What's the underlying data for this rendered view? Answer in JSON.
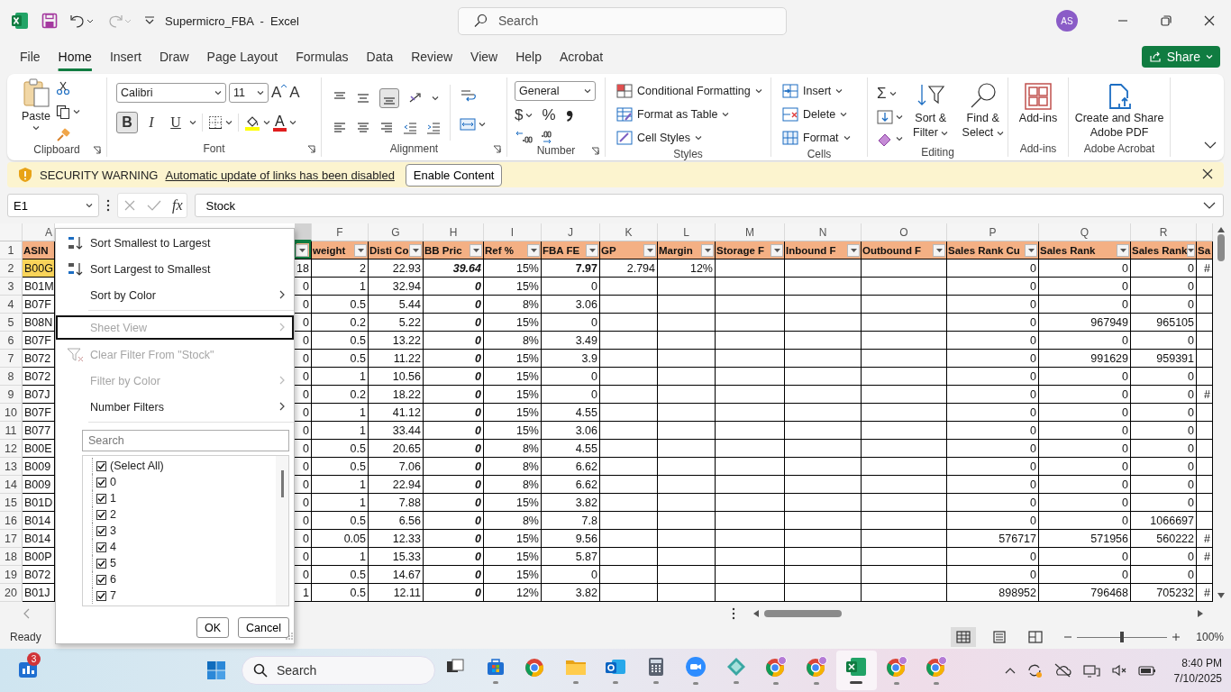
{
  "title_bar": {
    "title": "Supermicro_FBA  -  Excel",
    "search_placeholder": "Search",
    "user_initials": "AS"
  },
  "tabs": [
    {
      "label": "File",
      "selected": false
    },
    {
      "label": "Home",
      "selected": true
    },
    {
      "label": "Insert",
      "selected": false
    },
    {
      "label": "Draw",
      "selected": false
    },
    {
      "label": "Page Layout",
      "selected": false
    },
    {
      "label": "Formulas",
      "selected": false
    },
    {
      "label": "Data",
      "selected": false
    },
    {
      "label": "Review",
      "selected": false
    },
    {
      "label": "View",
      "selected": false
    },
    {
      "label": "Help",
      "selected": false
    },
    {
      "label": "Acrobat",
      "selected": false
    }
  ],
  "share_button": "Share",
  "ribbon": {
    "groups": [
      {
        "kind": "clipboard",
        "label": "Clipboard",
        "launcher": true,
        "paste": "Paste"
      },
      {
        "kind": "font",
        "label": "Font",
        "launcher": true,
        "font_name": "Calibri",
        "font_size": "11",
        "grow": "A",
        "shrink": "A",
        "bold": {
          "label": "B",
          "pressed": true
        },
        "italic": {
          "label": "I",
          "pressed": false
        },
        "underline": {
          "label": "U",
          "pressed": false
        },
        "font_color": "A"
      },
      {
        "kind": "alignment",
        "label": "Alignment",
        "launcher": true,
        "bottom_align_pressed": true
      },
      {
        "kind": "number",
        "label": "Number",
        "launcher": true,
        "format": "General",
        "currency": "$",
        "percent": "%"
      },
      {
        "kind": "styles",
        "label": "Styles",
        "launcher": false,
        "items": [
          "Conditional Formatting",
          "Format as Table",
          "Cell Styles"
        ]
      },
      {
        "kind": "cells",
        "label": "Cells",
        "launcher": false,
        "items": [
          "Insert",
          "Delete",
          "Format"
        ]
      },
      {
        "kind": "editing",
        "label": "Editing",
        "launcher": false,
        "autosum": "Σ",
        "items": [
          "Sort & Filter",
          "Find & Select"
        ]
      },
      {
        "kind": "addins",
        "label": "Add-ins",
        "launcher": false,
        "button": "Add-ins"
      },
      {
        "kind": "acrobat",
        "label": "Adobe Acrobat",
        "launcher": false,
        "button": "Create and Share Adobe PDF"
      }
    ]
  },
  "security_bar": {
    "label": "SECURITY WARNING",
    "message": "Automatic update of links has been disabled",
    "button": "Enable Content"
  },
  "formula_bar": {
    "name_box": "E1",
    "function_label": "fx",
    "formula": "Stock"
  },
  "sheet": {
    "header_row_number": "1",
    "columns": [
      {
        "kind": "text",
        "letter": "A",
        "header": "ASIN",
        "filter": false,
        "selected": false
      },
      {
        "kind": "number",
        "filter": true,
        "selected": true
      },
      {
        "kind": "number",
        "letter": "F",
        "header": "weight",
        "filter": true,
        "selected": false
      },
      {
        "kind": "number",
        "letter": "G",
        "header": "Disti Co",
        "filter": true,
        "selected": false
      },
      {
        "kind": "emphasized",
        "letter": "H",
        "header": "BB Pric",
        "filter": true,
        "selected": false
      },
      {
        "kind": "number",
        "letter": "I",
        "header": "Ref %",
        "filter": true,
        "selected": false
      },
      {
        "kind": "number",
        "letter": "J",
        "header": "FBA FE",
        "filter": true,
        "selected": false
      },
      {
        "kind": "number",
        "letter": "K",
        "header": "GP",
        "filter": true,
        "selected": false
      },
      {
        "kind": "number",
        "letter": "L",
        "header": "Margin",
        "filter": true,
        "selected": false
      },
      {
        "kind": "number",
        "letter": "M",
        "header": "Storage F",
        "filter": true,
        "selected": false
      },
      {
        "kind": "number",
        "letter": "N",
        "header": "Inbound F",
        "filter": true,
        "selected": false
      },
      {
        "kind": "number",
        "letter": "O",
        "header": "Outbound F",
        "filter": true,
        "selected": false
      },
      {
        "kind": "number",
        "letter": "P",
        "header": "Sales Rank Cu",
        "filter": true,
        "selected": false
      },
      {
        "kind": "number",
        "letter": "Q",
        "header": "Sales Rank",
        "filter": true,
        "selected": false
      },
      {
        "kind": "number",
        "letter": "R",
        "header": "Sales Rank",
        "filter": true,
        "selected": false
      },
      {
        "kind": "number",
        "header": "Sa",
        "filter": false,
        "selected": false
      }
    ],
    "rows": [
      {
        "number": "2",
        "cells": [
          {
            "text": "B00G",
            "highlighted": true
          },
          "18",
          "2",
          "22.93",
          "39.64",
          "15%",
          {
            "text": "7.97",
            "bold": true
          },
          "2.794",
          "12%",
          null,
          null,
          null,
          "0",
          "0",
          "0",
          "#"
        ]
      },
      {
        "number": "3",
        "cells": [
          "B01M",
          "0",
          "1",
          "32.94",
          "0",
          "15%",
          "0",
          null,
          null,
          null,
          null,
          null,
          "0",
          "0",
          "0",
          null
        ]
      },
      {
        "number": "4",
        "cells": [
          "B07F",
          "0",
          "0.5",
          "5.44",
          "0",
          "8%",
          "3.06",
          null,
          null,
          null,
          null,
          null,
          "0",
          "0",
          "0",
          null
        ]
      },
      {
        "number": "5",
        "cells": [
          "B08N",
          "0",
          "0.2",
          "5.22",
          "0",
          "15%",
          "0",
          null,
          null,
          null,
          null,
          null,
          "0",
          "967949",
          "965105",
          null
        ]
      },
      {
        "number": "6",
        "cells": [
          "B07F",
          "0",
          "0.5",
          "13.22",
          "0",
          "8%",
          "3.49",
          null,
          null,
          null,
          null,
          null,
          "0",
          "0",
          "0",
          null
        ]
      },
      {
        "number": "7",
        "cells": [
          "B072",
          "0",
          "0.5",
          "11.22",
          "0",
          "15%",
          "3.9",
          null,
          null,
          null,
          null,
          null,
          "0",
          "991629",
          "959391",
          null
        ]
      },
      {
        "number": "8",
        "cells": [
          "B072",
          "0",
          "1",
          "10.56",
          "0",
          "15%",
          "0",
          null,
          null,
          null,
          null,
          null,
          "0",
          "0",
          "0",
          null
        ]
      },
      {
        "number": "9",
        "cells": [
          "B07J",
          "0",
          "0.2",
          "18.22",
          "0",
          "15%",
          "0",
          null,
          null,
          null,
          null,
          null,
          "0",
          "0",
          "0",
          "#"
        ]
      },
      {
        "number": "10",
        "cells": [
          "B07F",
          "0",
          "1",
          "41.12",
          "0",
          "15%",
          "4.55",
          null,
          null,
          null,
          null,
          null,
          "0",
          "0",
          "0",
          null
        ]
      },
      {
        "number": "11",
        "cells": [
          "B077",
          "0",
          "1",
          "33.44",
          "0",
          "15%",
          "3.06",
          null,
          null,
          null,
          null,
          null,
          "0",
          "0",
          "0",
          null
        ]
      },
      {
        "number": "12",
        "cells": [
          "B00E",
          "0",
          "0.5",
          "20.65",
          "0",
          "8%",
          "4.55",
          null,
          null,
          null,
          null,
          null,
          "0",
          "0",
          "0",
          null
        ]
      },
      {
        "number": "13",
        "cells": [
          "B009",
          "0",
          "0.5",
          "7.06",
          "0",
          "8%",
          "6.62",
          null,
          null,
          null,
          null,
          null,
          "0",
          "0",
          "0",
          null
        ]
      },
      {
        "number": "14",
        "cells": [
          "B009",
          "0",
          "1",
          "22.94",
          "0",
          "8%",
          "6.62",
          null,
          null,
          null,
          null,
          null,
          "0",
          "0",
          "0",
          null
        ]
      },
      {
        "number": "15",
        "cells": [
          "B01D",
          "0",
          "1",
          "7.88",
          "0",
          "15%",
          "3.82",
          null,
          null,
          null,
          null,
          null,
          "0",
          "0",
          "0",
          null
        ]
      },
      {
        "number": "16",
        "cells": [
          "B014",
          "0",
          "0.5",
          "6.56",
          "0",
          "8%",
          "7.8",
          null,
          null,
          null,
          null,
          null,
          "0",
          "0",
          "1066697",
          null
        ]
      },
      {
        "number": "17",
        "cells": [
          "B014",
          "0",
          "0.05",
          "12.33",
          "0",
          "15%",
          "9.56",
          null,
          null,
          null,
          null,
          null,
          "576717",
          "571956",
          "560222",
          "#"
        ]
      },
      {
        "number": "18",
        "cells": [
          "B00P",
          "0",
          "1",
          "15.33",
          "0",
          "15%",
          "5.87",
          null,
          null,
          null,
          null,
          null,
          "0",
          "0",
          "0",
          "#"
        ]
      },
      {
        "number": "19",
        "cells": [
          "B072",
          "0",
          "0.5",
          "14.67",
          "0",
          "15%",
          "0",
          null,
          null,
          null,
          null,
          null,
          "0",
          "0",
          "0",
          null
        ]
      },
      {
        "number": "20",
        "cells": [
          "B01J",
          "1",
          "0.5",
          "12.11",
          "0",
          "12%",
          "3.82",
          null,
          null,
          null,
          null,
          null,
          "898952",
          "796468",
          "705232",
          "#"
        ]
      }
    ]
  },
  "filter_menu": {
    "items": [
      {
        "kind": "sort-ascending",
        "label": "Sort Smallest to Largest",
        "disabled": false,
        "submenu": false,
        "focused": false
      },
      {
        "kind": "sort-descending",
        "label": "Sort Largest to Smallest",
        "disabled": false,
        "submenu": false,
        "focused": false
      },
      {
        "kind": "plain",
        "label": "Sort by Color",
        "disabled": false,
        "submenu": true,
        "focused": false
      },
      {
        "kind": "separator"
      },
      {
        "kind": "plain",
        "label": "Sheet View",
        "disabled": true,
        "submenu": true,
        "focused": true
      },
      {
        "kind": "clear-filter",
        "label": "Clear Filter From \"Stock\"",
        "disabled": true,
        "submenu": false,
        "focused": false
      },
      {
        "kind": "plain",
        "label": "Filter by Color",
        "disabled": true,
        "submenu": true,
        "focused": false
      },
      {
        "kind": "plain",
        "label": "Number Filters",
        "disabled": false,
        "submenu": true,
        "focused": false
      },
      {
        "kind": "separator"
      }
    ],
    "search_placeholder": "Search",
    "values": [
      {
        "label": "(Select All)",
        "checked": true
      },
      {
        "label": "0",
        "checked": true
      },
      {
        "label": "1",
        "checked": true
      },
      {
        "label": "2",
        "checked": true
      },
      {
        "label": "3",
        "checked": true
      },
      {
        "label": "4",
        "checked": true
      },
      {
        "label": "5",
        "checked": true
      },
      {
        "label": "6",
        "checked": true
      },
      {
        "label": "7",
        "checked": true
      }
    ],
    "buttons": [
      "OK",
      "Cancel"
    ]
  },
  "status_bar": {
    "text": "Ready",
    "views": [
      {
        "kind": "normal",
        "selected": true
      },
      {
        "kind": "page-layout",
        "selected": false
      },
      {
        "kind": "page-break-preview",
        "selected": false
      }
    ],
    "zoom": {
      "level": 0.5,
      "reading": "100%"
    }
  },
  "taskbar": {
    "widgets_badge": "3",
    "search_placeholder": "Search",
    "apps": [
      {
        "kind": "task-view",
        "running": false,
        "active": false
      },
      {
        "kind": "store",
        "running": true,
        "active": false
      },
      {
        "kind": "browser",
        "running": false,
        "active": false
      },
      {
        "kind": "folder",
        "running": true,
        "active": false
      },
      {
        "kind": "mail",
        "running": true,
        "active": false
      },
      {
        "kind": "calculator",
        "running": true,
        "active": false
      },
      {
        "kind": "meeting",
        "running": true,
        "active": false
      },
      {
        "kind": "diamond",
        "running": true,
        "active": false
      },
      {
        "kind": "browser-profile",
        "running": true,
        "active": false
      },
      {
        "kind": "browser-profile",
        "running": true,
        "active": false
      },
      {
        "kind": "spreadsheet",
        "running": true,
        "active": true
      },
      {
        "kind": "browser-profile",
        "running": true,
        "active": false
      },
      {
        "kind": "browser-profile",
        "running": true,
        "active": false
      }
    ],
    "clock": {
      "time": "8:40 PM",
      "date": "7/10/2025"
    }
  }
}
